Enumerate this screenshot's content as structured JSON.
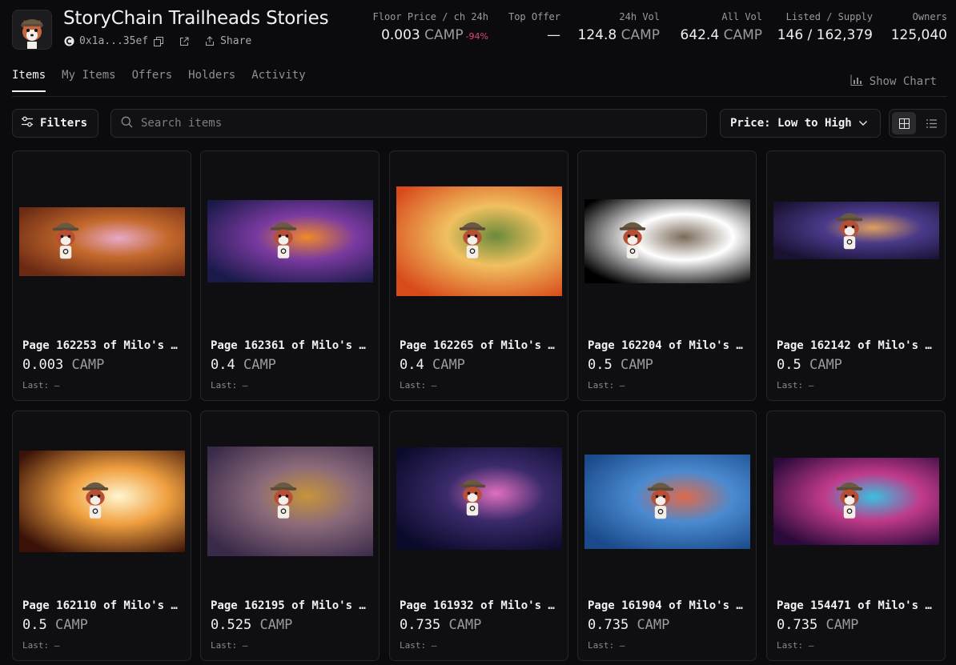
{
  "collection": {
    "title": "StoryChain Trailheads Stories",
    "address": "0x1a...35ef",
    "share_label": "Share"
  },
  "stats": [
    {
      "label": "Floor Price / ch 24h",
      "value": "0.003",
      "currency": "CAMP",
      "change": "-94%"
    },
    {
      "label": "Top Offer",
      "value": "—",
      "currency": "",
      "change": ""
    },
    {
      "label": "24h Vol",
      "value": "124.8",
      "currency": "CAMP",
      "change": ""
    },
    {
      "label": "All Vol",
      "value": "642.4",
      "currency": "CAMP",
      "change": ""
    },
    {
      "label": "Listed / Supply",
      "value": "146 / 162,379",
      "currency": "",
      "change": ""
    },
    {
      "label": "Owners",
      "value": "125,040",
      "currency": "",
      "change": ""
    }
  ],
  "tabs": [
    {
      "label": "Items",
      "active": true
    },
    {
      "label": "My Items",
      "active": false
    },
    {
      "label": "Offers",
      "active": false
    },
    {
      "label": "Holders",
      "active": false
    },
    {
      "label": "Activity",
      "active": false
    }
  ],
  "show_chart_label": "Show Chart",
  "toolbar": {
    "filters_label": "Filters",
    "search_placeholder": "Search items",
    "sort_label": "Price: Low to High",
    "view_mode": "grid"
  },
  "items": [
    {
      "name": "Page 162253 of Milo's …",
      "price": "0.003",
      "currency": "CAMP",
      "last": "Last: —",
      "palette": [
        "#6b2a14",
        "#c4692c",
        "#e8a9c8"
      ]
    },
    {
      "name": "Page 162361 of Milo's …",
      "price": "0.4",
      "currency": "CAMP",
      "last": "Last: —",
      "palette": [
        "#1a1a4a",
        "#7a3aa0",
        "#f08a2a"
      ]
    },
    {
      "name": "Page 162265 of Milo's …",
      "price": "0.4",
      "currency": "CAMP",
      "last": "Last: —",
      "palette": [
        "#d84a1a",
        "#f0c060",
        "#6a8a3a"
      ]
    },
    {
      "name": "Page 162204 of Milo's …",
      "price": "0.5",
      "currency": "CAMP",
      "last": "Last: —",
      "palette": [
        "#000000",
        "#ffffff",
        "#7a6a5a"
      ]
    },
    {
      "name": "Page 162142 of Milo's …",
      "price": "0.5",
      "currency": "CAMP",
      "last": "Last: —",
      "palette": [
        "#1a1030",
        "#4a3a8a",
        "#e0a060"
      ]
    },
    {
      "name": "Page 162110 of Milo's …",
      "price": "0.5",
      "currency": "CAMP",
      "last": "Last: —",
      "palette": [
        "#3a1208",
        "#f0a040",
        "#fff6d0"
      ]
    },
    {
      "name": "Page 162195 of Milo's …",
      "price": "0.525",
      "currency": "CAMP",
      "last": "Last: —",
      "palette": [
        "#3a2a4a",
        "#8a6a7a",
        "#c8943a"
      ]
    },
    {
      "name": "Page 161932 of Milo's …",
      "price": "0.735",
      "currency": "CAMP",
      "last": "Last: —",
      "palette": [
        "#0a0a2a",
        "#3a2a6a",
        "#e070c0"
      ]
    },
    {
      "name": "Page 161904 of Milo's …",
      "price": "0.735",
      "currency": "CAMP",
      "last": "Last: —",
      "palette": [
        "#1a4a8a",
        "#4a8ad0",
        "#e06a4a"
      ]
    },
    {
      "name": "Page 154471 of Milo's …",
      "price": "0.735",
      "currency": "CAMP",
      "last": "Last: —",
      "palette": [
        "#2a0a3a",
        "#c03a8a",
        "#3ac0e0"
      ]
    }
  ]
}
